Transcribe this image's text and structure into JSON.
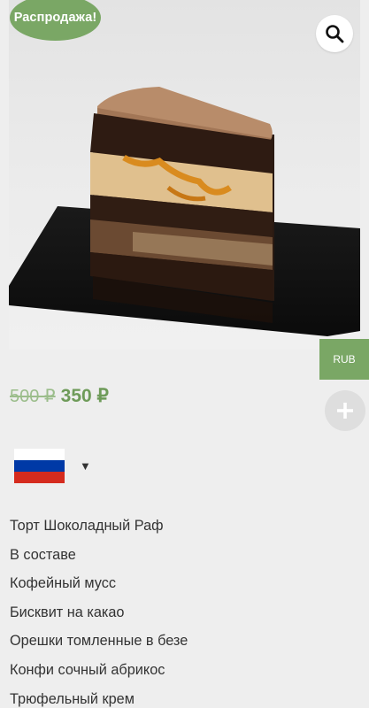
{
  "product": {
    "sale_badge": "Распродажа!",
    "image_alt": "Торт Шоколадный Раф",
    "price_old": "500 ₽",
    "price_new": "350 ₽"
  },
  "currency": {
    "label": "RUB"
  },
  "language": {
    "flag": "flag-ru-icon",
    "flag_colors": [
      "#ffffff",
      "#0039a6",
      "#d52b1e"
    ]
  },
  "description": {
    "lines": [
      "Торт Шоколадный Раф",
      "В составе",
      "Кофейный мусс",
      "Бисквит на какао",
      "Орешки томленные в безе",
      "Конфи сочный абрикос",
      "Трюфельный крем"
    ]
  },
  "colors": {
    "accent": "#7aa765",
    "price": "#6e9b59",
    "background": "#eeeeee"
  },
  "icons": {
    "zoom": "search-icon",
    "add": "plus-icon",
    "dropdown": "caret-down-icon"
  }
}
